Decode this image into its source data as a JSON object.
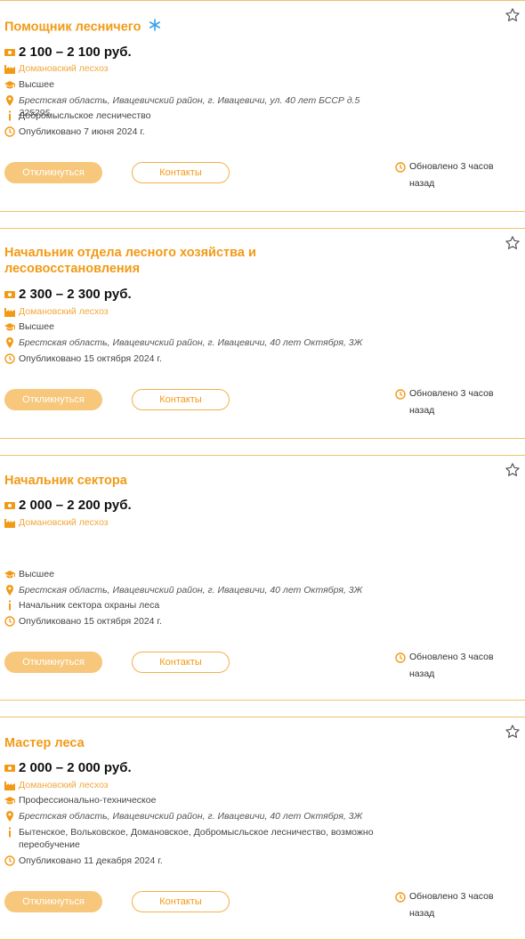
{
  "colors": {
    "accent": "#f29a16",
    "button_fill": "#f7c77b",
    "divider": "#f3c167"
  },
  "icons": [
    "money-icon",
    "factory-icon",
    "graduation-cap-icon",
    "location-pin-icon",
    "info-icon",
    "clock-icon",
    "star-icon",
    "sparkle-icon"
  ],
  "vacancies": [
    {
      "title": "Помощник лесничего",
      "salary": "2 100 – 2 100 руб.",
      "company": "Домановский лесхоз",
      "education": "Высшее",
      "address": "Брестская область, Ивацевичский район, г. Ивацевичи, ул. 40 лет БССР д.5 225295",
      "info": "Добромысльское лесничество",
      "published": "Опубликовано 7 июня 2024 г.",
      "respond_label": "Откликнуться",
      "contacts_label": "Контакты",
      "updated": "Обновлено 3 часов назад"
    },
    {
      "title": "Начальник отдела лесного хозяйства и лесовосстановления",
      "salary": "2 300 – 2 300 руб.",
      "company": "Домановский лесхоз",
      "education": "Высшее",
      "address": "Брестская область, Ивацевичский район, г. Ивацевичи, 40 лет Октября, 3Ж",
      "published": "Опубликовано 15 октября 2024 г.",
      "respond_label": "Откликнуться",
      "contacts_label": "Контакты",
      "updated": "Обновлено 3 часов назад"
    },
    {
      "title": "Начальник сектора",
      "salary": "2 000 – 2 200 руб.",
      "company": "Домановский лесхоз",
      "education": "Высшее",
      "address": "Брестская область, Ивацевичский район, г. Ивацевичи, 40 лет Октября, 3Ж",
      "info": "Начальник сектора охраны леса",
      "published": "Опубликовано 15 октября 2024 г.",
      "respond_label": "Откликнуться",
      "contacts_label": "Контакты",
      "updated": "Обновлено 3 часов назад"
    },
    {
      "title": "Мастер леса",
      "salary": "2 000 – 2 000 руб.",
      "company": "Домановский лесхоз",
      "education": "Профессионально-техническое",
      "address": "Брестская область, Ивацевичский район, г. Ивацевичи, 40 лет Октября, 3Ж",
      "info": "Бытенское, Вольковское, Домановское, Добромысльское лесничество, возможно переобучение",
      "published": "Опубликовано 11 декабря 2024 г.",
      "respond_label": "Откликнуться",
      "contacts_label": "Контакты",
      "updated": "Обновлено 3 часов назад"
    }
  ]
}
